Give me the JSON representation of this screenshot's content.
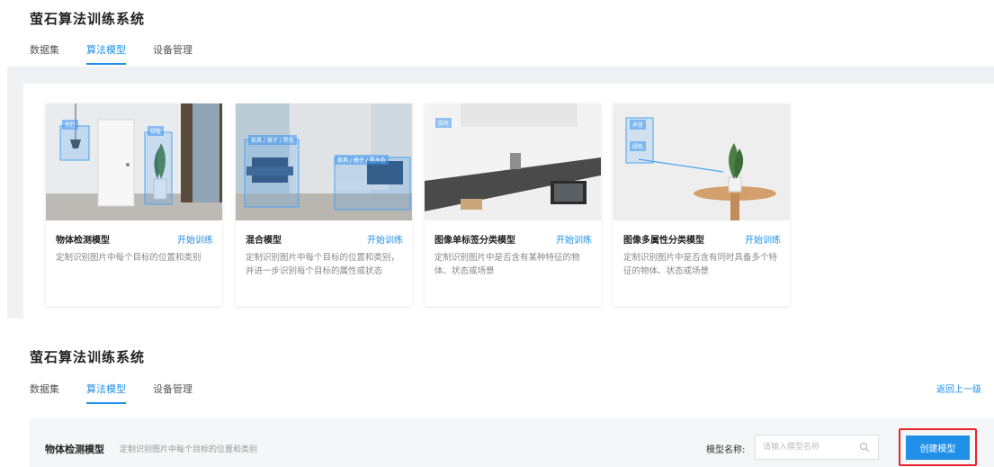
{
  "top": {
    "app_title": "萤石算法训练系统",
    "tabs": [
      {
        "label": "数据集",
        "active": false
      },
      {
        "label": "算法模型",
        "active": true
      },
      {
        "label": "设备管理",
        "active": false
      }
    ]
  },
  "cards": [
    {
      "name": "物体检测模型",
      "action": "开始训练",
      "desc": "定制识别图片中每个目标的位置和类别",
      "tags": [
        "吊灯",
        "绿植"
      ]
    },
    {
      "name": "混合模型",
      "action": "开始训练",
      "desc": "定制识别图片中每个目标的位置和类别，并进一步识别每个目标的属性或状态",
      "tags": [
        "家具 / 椅子 / 黑色",
        "家具 / 椅子 / 黑木色"
      ]
    },
    {
      "name": "图像单标签分类模型",
      "action": "开始训练",
      "desc": "定制识别图片中是否含有某种特征的物体、状态或场景",
      "tags": [
        "厨房"
      ]
    },
    {
      "name": "图像多属性分类模型",
      "action": "开始训练",
      "desc": "定制识别图片中是否含有同时具备多个特征的物体、状态或场景",
      "tags": [
        "声音",
        "绿色"
      ]
    }
  ],
  "bottom": {
    "app_title": "萤石算法训练系统",
    "tabs": [
      {
        "label": "数据集",
        "active": false
      },
      {
        "label": "算法模型",
        "active": true
      },
      {
        "label": "设备管理",
        "active": false
      }
    ],
    "back_link": "返回上一级",
    "model_title": "物体检测模型",
    "model_desc": "定制识别图片中每个目标的位置和类别",
    "search_label": "模型名称:",
    "search_placeholder": "请输入模型名称",
    "create_button": "创建模型"
  },
  "colors": {
    "accent": "#1f8fe8",
    "highlight": "#e8232b",
    "panel_bg": "#eff1f5"
  }
}
